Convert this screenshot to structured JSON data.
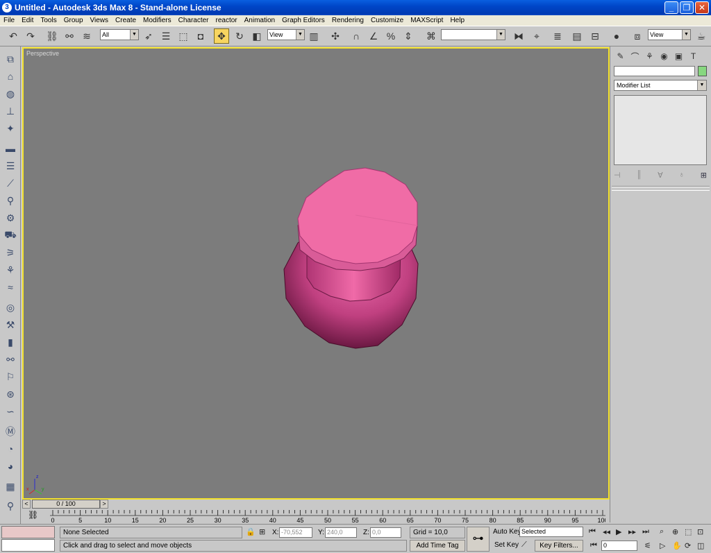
{
  "window": {
    "title": "Untitled   - Autodesk 3ds Max 8  - Stand-alone License",
    "app_icon": "3",
    "minimize_glyph": "_",
    "maximize_glyph": "❐",
    "close_glyph": "✕"
  },
  "menu": [
    "File",
    "Edit",
    "Tools",
    "Group",
    "Views",
    "Create",
    "Modifiers",
    "Character",
    "reactor",
    "Animation",
    "Graph Editors",
    "Rendering",
    "Customize",
    "MAXScript",
    "Help"
  ],
  "toolbar": {
    "selection_filter": "All",
    "reference_coord": "View",
    "named_selection": "",
    "render_type": "View",
    "active_tool": "select-and-move"
  },
  "viewport": {
    "label": "Perspective",
    "axis_x": "x",
    "axis_y": "y",
    "axis_z": "z",
    "object_color": "#e8589a",
    "border_color": "#f4e22c"
  },
  "command_panel": {
    "object_name": "",
    "modifier_list": "Modifier List",
    "object_color": "#87d77f"
  },
  "time_slider": {
    "position": "0 / 100",
    "prev": "<",
    "next": ">"
  },
  "track_bar": {
    "ticks": [
      "0",
      "5",
      "10",
      "15",
      "20",
      "25",
      "30",
      "35",
      "40",
      "45",
      "50",
      "55",
      "60",
      "65",
      "70",
      "75",
      "80",
      "85",
      "90",
      "95",
      "100"
    ]
  },
  "status": {
    "selection": "None Selected",
    "prompt": "Click and drag to select and move objects",
    "x_label": "X:",
    "x_value": "-70,552",
    "y_label": "Y:",
    "y_value": "240,0",
    "z_label": "Z:",
    "z_value": "0,0",
    "grid": "Grid = 10,0",
    "add_time_tag": "Add Time Tag",
    "auto_key": "Auto Key",
    "set_key": "Set Key",
    "key_mode": "Selected",
    "key_filters": "Key Filters...",
    "current_frame": "0"
  }
}
